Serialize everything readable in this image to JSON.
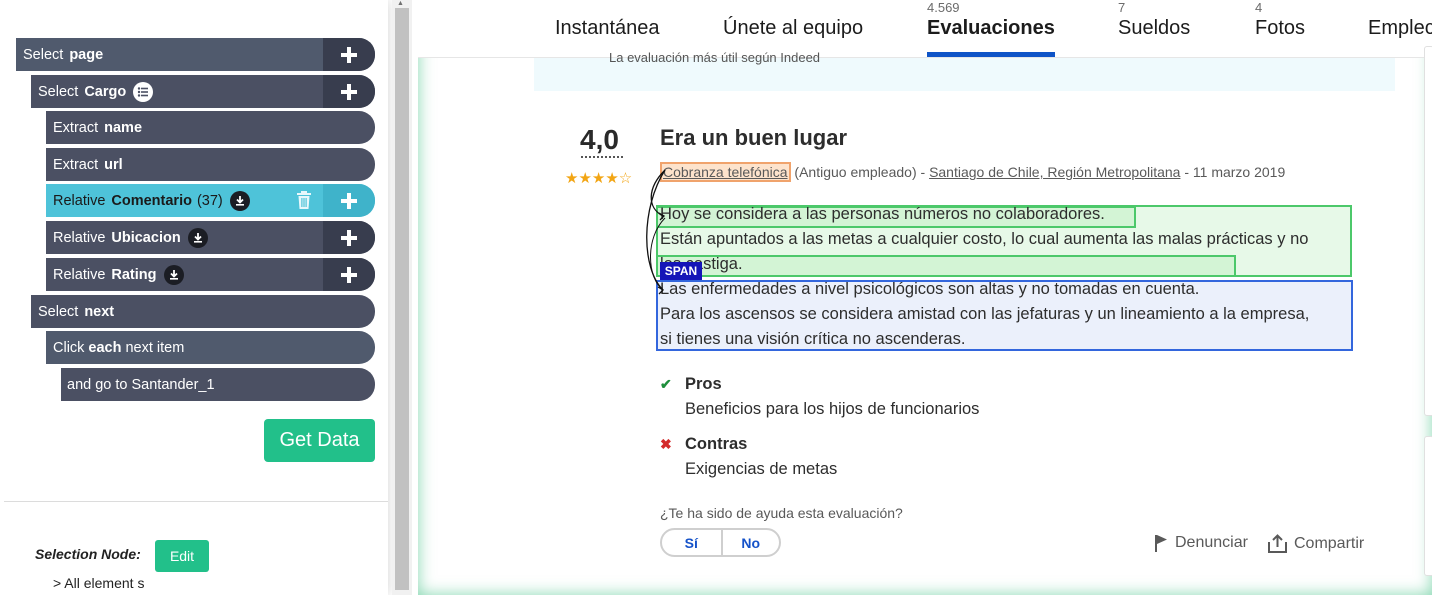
{
  "extension": {
    "commands": [
      {
        "verb": "Select",
        "name": "page",
        "rest": ""
      },
      {
        "verb": "Select",
        "name": "Cargo",
        "rest": ""
      },
      {
        "verb": "Extract",
        "name": "name",
        "rest": ""
      },
      {
        "verb": "Extract",
        "name": "url",
        "rest": ""
      },
      {
        "verb": "Relative",
        "name": "Comentario",
        "rest": "(37)"
      },
      {
        "verb": "Relative",
        "name": "Ubicacion",
        "rest": ""
      },
      {
        "verb": "Relative",
        "name": "Rating",
        "rest": ""
      },
      {
        "verb": "Select",
        "name": "next",
        "rest": ""
      },
      {
        "verb": "Click",
        "name": "each",
        "rest": "next item"
      },
      {
        "verb": "and go to Santander_1",
        "name": "",
        "rest": ""
      }
    ],
    "get_data_label": "Get Data",
    "selection_node_label": "Selection Node:",
    "edit_label": "Edit",
    "all_elements_label": "> All element s",
    "accent_green": "#22c08a",
    "accent_cyan": "#4ec3d9"
  },
  "site": {
    "tabs": [
      {
        "label": "Instantánea",
        "count": ""
      },
      {
        "label": "Únete al equipo",
        "count": ""
      },
      {
        "label": "Evaluaciones",
        "count": "4.569"
      },
      {
        "label": "Sueldos",
        "count": "7"
      },
      {
        "label": "Fotos",
        "count": "4"
      },
      {
        "label": "Emplec",
        "count": ""
      }
    ],
    "active_tab": "Evaluaciones",
    "info_text": "La evaluación más útil según Indeed",
    "review": {
      "rating": "4,0",
      "stars": "★★★★☆",
      "title": "Era un buen lugar",
      "job_title": "Cobranza telefónica",
      "status": "(Antiguo empleado) - ",
      "location": "Santiago de Chile, Región Metropolitana",
      "date": " - 11 marzo 2019",
      "body_lines": [
        "Hoy se considera a las personas números no colaboradores.",
        "Están apuntados a las metas a cualquier costo, lo cual aumenta las malas prácticas y no",
        "los castiga.",
        "Las enfermedades a nivel psicológicos son altas y no tomadas en cuenta.",
        "Para los ascensos se considera amistad con las jefaturas y un lineamiento a la empresa,",
        "si tienes una visión crítica no ascenderas."
      ],
      "span_tag": "SPAN",
      "pros_label": "Pros",
      "pros_text": "Beneficios para los hijos de funcionarios",
      "cons_label": "Contras",
      "cons_text": "Exigencias de metas",
      "helpful_question": "¿Te ha sido de ayuda esta evaluación?",
      "yes_label": "Sí",
      "no_label": "No",
      "report_label": "Denunciar",
      "share_label": "Compartir"
    },
    "active_color": "#0f54c7"
  }
}
